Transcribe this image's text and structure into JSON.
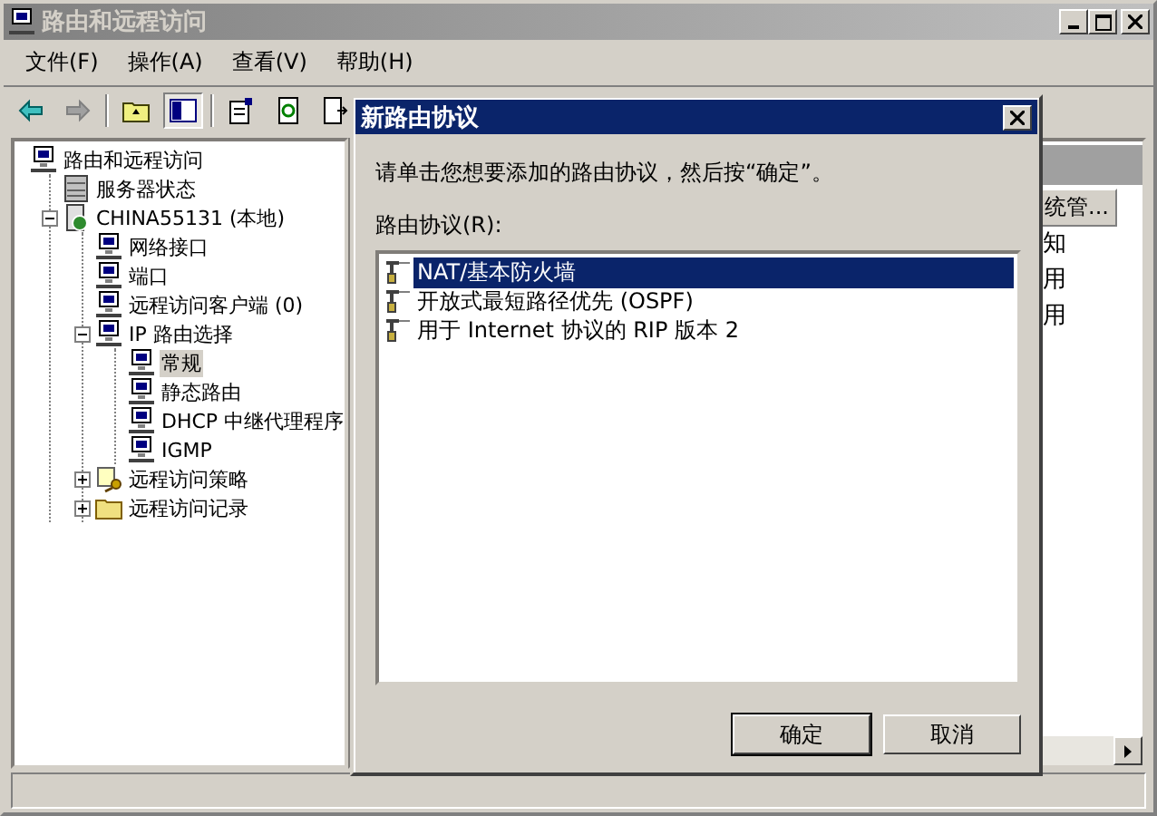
{
  "window": {
    "title": "路由和远程访问"
  },
  "menu": [
    "文件(F)",
    "操作(A)",
    "查看(V)",
    "帮助(H)"
  ],
  "tree": [
    {
      "label": "路由和远程访问",
      "kind": "computer",
      "selected": false,
      "children": [
        {
          "label": "服务器状态",
          "kind": "server",
          "selected": false
        },
        {
          "label": "CHINA55131 (本地)",
          "kind": "host",
          "selected": false,
          "expanded": true,
          "children": [
            {
              "label": "网络接口",
              "kind": "computer",
              "selected": false
            },
            {
              "label": "端口",
              "kind": "computer",
              "selected": false
            },
            {
              "label": "远程访问客户端 (0)",
              "kind": "computer",
              "selected": false
            },
            {
              "label": "IP 路由选择",
              "kind": "computer",
              "selected": false,
              "expanded": true,
              "children": [
                {
                  "label": "常规",
                  "kind": "computer",
                  "selected": true
                },
                {
                  "label": "静态路由",
                  "kind": "computer",
                  "selected": false
                },
                {
                  "label": "DHCP 中继代理程序",
                  "kind": "computer",
                  "selected": false
                },
                {
                  "label": "IGMP",
                  "kind": "computer",
                  "selected": false
                }
              ]
            },
            {
              "label": "远程访问策略",
              "kind": "policy",
              "selected": false,
              "expanded": false
            },
            {
              "label": "远程访问记录",
              "kind": "folder",
              "selected": false,
              "expanded": false
            }
          ]
        }
      ]
    }
  ],
  "list": {
    "column": "统管...",
    "cells": [
      "知",
      "用",
      "用"
    ]
  },
  "dialog": {
    "title": "新路由协议",
    "instruction": "请单击您想要添加的路由协议，然后按“确定”。",
    "list_label": "路由协议(R):",
    "protocols": [
      {
        "label": "NAT/基本防火墙",
        "selected": true
      },
      {
        "label": "开放式最短路径优先 (OSPF)",
        "selected": false
      },
      {
        "label": "用于 Internet 协议的 RIP 版本 2",
        "selected": false
      }
    ],
    "buttons": [
      "确定",
      "取消"
    ]
  }
}
